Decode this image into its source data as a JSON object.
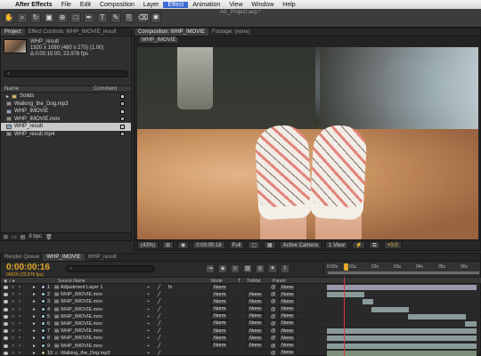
{
  "menubar": {
    "apple": "",
    "app": "After Effects",
    "items": [
      "File",
      "Edit",
      "Composition",
      "Layer",
      "Effect",
      "Animation",
      "View",
      "Window",
      "Help"
    ],
    "active": "Effect"
  },
  "toolbar": {
    "title": "AE_Project.aep *",
    "tools": [
      "hand-tool-icon",
      "zoom-tool-icon",
      "rotate-tool-icon",
      "camera-tool-icon",
      "pan-behind-icon",
      "mask-tool-icon",
      "pen-tool-icon",
      "type-tool-icon",
      "brush-tool-icon",
      "clone-tool-icon",
      "eraser-tool-icon",
      "puppet-tool-icon"
    ]
  },
  "project": {
    "tabs": [
      "Project",
      "Effect Controls: WHP_IMOVIE_result"
    ],
    "selected_name": "WHP_result",
    "meta1": "1920 x 1080 (480 x 270) (1.00)",
    "meta2": "Δ 0:00:15:00, 23.976 fps",
    "search_placeholder": "⌕",
    "col_name": "Name",
    "col_comment": "Comment",
    "items": [
      {
        "name": "Solids",
        "kind": "folder",
        "color": "#c9c9c9",
        "selected": false
      },
      {
        "name": "Walking_the_Dog.mp3",
        "kind": "file",
        "color": "#a5a5a5",
        "selected": false
      },
      {
        "name": "WHP_IMOVIE",
        "kind": "comp",
        "color": "#c9c9c9",
        "selected": false
      },
      {
        "name": "WHP_IMOVIE.mov",
        "kind": "file",
        "color": "#a5a5a5",
        "selected": false
      },
      {
        "name": "WHP_result",
        "kind": "comp",
        "color": "#c9c9c9",
        "selected": true
      },
      {
        "name": "WHP_result.mp4",
        "kind": "file",
        "color": "#a5a5a5",
        "selected": false
      }
    ],
    "footer_bpc": "8 bpc"
  },
  "viewer": {
    "tab_composition": "Composition: WHP_IMOVIE",
    "tab_footage": "Footage: (none)",
    "sub_tab": "WHP_IMOVIE",
    "footer": {
      "zoom": "(43%)",
      "timecode": "0:00:00:16",
      "resolution": "Full",
      "camera": "Active Camera",
      "views": "1 View",
      "exposure": "+0.0"
    }
  },
  "timeline": {
    "tabs": [
      "Render Queue",
      "WHP_IMOVIE",
      "WHP_result"
    ],
    "time": "0:00:00:16",
    "fps_line": "00016 (23.976 fps)",
    "search_placeholder": "⌕",
    "ruler_ticks": [
      "0:00s",
      "01s",
      "02s",
      "03s",
      "04s",
      "05s",
      "06s",
      "07s"
    ],
    "headers": {
      "source": "Source Name",
      "mode": "Mode",
      "t": "T",
      "trkmat": "TrkMat",
      "parent": "Parent"
    },
    "layers": [
      {
        "num": "1",
        "name": "Adjustment Layer 1",
        "mode": "Norm",
        "trkmat": "",
        "parent": "None",
        "bar_start": 0.0,
        "bar_end": 1.0,
        "label": "#a9a6c7",
        "type": "adj"
      },
      {
        "num": "2",
        "name": "WHP_IMOVIE.mov",
        "mode": "Norm",
        "trkmat": "None",
        "parent": "None",
        "bar_start": 0.0,
        "bar_end": 0.25,
        "label": "#8fb3c0",
        "type": "clip"
      },
      {
        "num": "3",
        "name": "WHP_IMOVIE.mov",
        "mode": "Norm",
        "trkmat": "None",
        "parent": "None",
        "bar_start": 0.24,
        "bar_end": 0.31,
        "label": "#8fb3c0",
        "type": "clip"
      },
      {
        "num": "4",
        "name": "WHP_IMOVIE.mov",
        "mode": "Norm",
        "trkmat": "None",
        "parent": "None",
        "bar_start": 0.3,
        "bar_end": 0.55,
        "label": "#8fb3c0",
        "type": "clip"
      },
      {
        "num": "5",
        "name": "WHP_IMOVIE.mov",
        "mode": "Norm",
        "trkmat": "None",
        "parent": "None",
        "bar_start": 0.54,
        "bar_end": 0.93,
        "label": "#8fb3c0",
        "type": "clip"
      },
      {
        "num": "6",
        "name": "WHP_IMOVIE.mov",
        "mode": "Norm",
        "trkmat": "None",
        "parent": "None",
        "bar_start": 0.92,
        "bar_end": 1.0,
        "label": "#8fb3c0",
        "type": "clip"
      },
      {
        "num": "7",
        "name": "WHP_IMOVIE.mov",
        "mode": "Norm",
        "trkmat": "None",
        "parent": "None",
        "bar_start": 0.0,
        "bar_end": 0.0,
        "label": "#8fb3c0",
        "type": "clip"
      },
      {
        "num": "8",
        "name": "WHP_IMOVIE.mov",
        "mode": "Norm",
        "trkmat": "None",
        "parent": "None",
        "bar_start": 0.0,
        "bar_end": 0.0,
        "label": "#8fb3c0",
        "type": "clip"
      },
      {
        "num": "9",
        "name": "WHP_IMOVIE.mov",
        "mode": "Norm",
        "trkmat": "None",
        "parent": "None",
        "bar_start": 0.0,
        "bar_end": 0.0,
        "label": "#8fb3c0",
        "type": "clip"
      },
      {
        "num": "10",
        "name": "Walking_the_Dog.mp3",
        "mode": "",
        "trkmat": "",
        "parent": "None",
        "bar_start": 0.0,
        "bar_end": 1.0,
        "label": "#9fb58b",
        "type": "audio"
      }
    ]
  }
}
